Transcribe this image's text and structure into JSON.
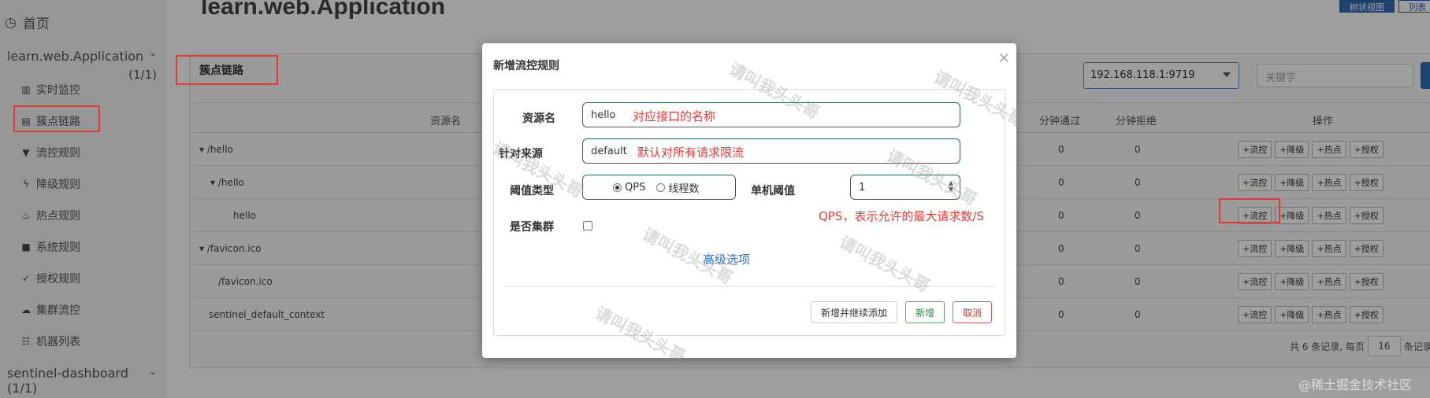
{
  "sidebar": {
    "home": "首页",
    "app_name": "learn.web.Application",
    "app_count": "(1/1)",
    "items": [
      {
        "label": "实时监控",
        "icon": "bar-chart-icon"
      },
      {
        "label": "簇点链路",
        "icon": "list-icon"
      },
      {
        "label": "流控规则",
        "icon": "filter-icon"
      },
      {
        "label": "降级规则",
        "icon": "bolt-icon"
      },
      {
        "label": "热点规则",
        "icon": "fire-icon"
      },
      {
        "label": "系统规则",
        "icon": "lock-icon"
      },
      {
        "label": "授权规则",
        "icon": "check-circle-icon"
      },
      {
        "label": "集群流控",
        "icon": "cloud-icon"
      },
      {
        "label": "机器列表",
        "icon": "th-list-icon"
      }
    ],
    "footer": "sentinel-dashboard (1/1)"
  },
  "page": {
    "title": "learn.web.Application",
    "view_tree": "树状视图",
    "view_list": "列表"
  },
  "panel": {
    "title": "簇点链路",
    "ip_select": "192.168.118.1:9719",
    "keyword_placeholder": "关键字"
  },
  "table": {
    "headers": {
      "resource": "资源名",
      "pass": "分钟通过",
      "block": "分钟拒绝",
      "ops": "操作"
    },
    "rows": [
      {
        "name": "▾ /hello",
        "pass": "0",
        "block": "0"
      },
      {
        "name": "▾ /hello",
        "pass": "0",
        "block": "0"
      },
      {
        "name": "hello",
        "pass": "0",
        "block": "0"
      },
      {
        "name": "▾ /favicon.ico",
        "pass": "0",
        "block": "0"
      },
      {
        "name": "/favicon.ico",
        "pass": "0",
        "block": "0"
      },
      {
        "name": "sentinel_default_context",
        "pass": "0",
        "block": "0"
      }
    ],
    "op_labels": [
      "+流控",
      "+降级",
      "+热点",
      "+授权"
    ]
  },
  "pager": {
    "text": "共 6 条记录, 每页",
    "size": "16",
    "suffix": "条记录"
  },
  "modal": {
    "title": "新增流控规则",
    "close": "×",
    "resource_label": "资源名",
    "resource_value": "hello",
    "source_label": "针对来源",
    "source_value": "default",
    "threshold_type_label": "阈值类型",
    "qps_label": "QPS",
    "thread_label": "线程数",
    "single_threshold_label": "单机阈值",
    "threshold_value": "1",
    "cluster_label": "是否集群",
    "advanced": "高级选项",
    "btn_continue": "新增并继续添加",
    "btn_add": "新增",
    "btn_cancel": "取消"
  },
  "annotations": {
    "resource": "对应接口的名称",
    "source": "默认对所有请求限流",
    "qps": "QPS，表示允许的最大请求数/S"
  },
  "watermark": "请叫我头头哥",
  "credit": "@稀土掘金技术社区",
  "colors": {
    "highlight": "#e03a3a",
    "primary": "#2f6db5",
    "annotation": "#e03a3a"
  }
}
